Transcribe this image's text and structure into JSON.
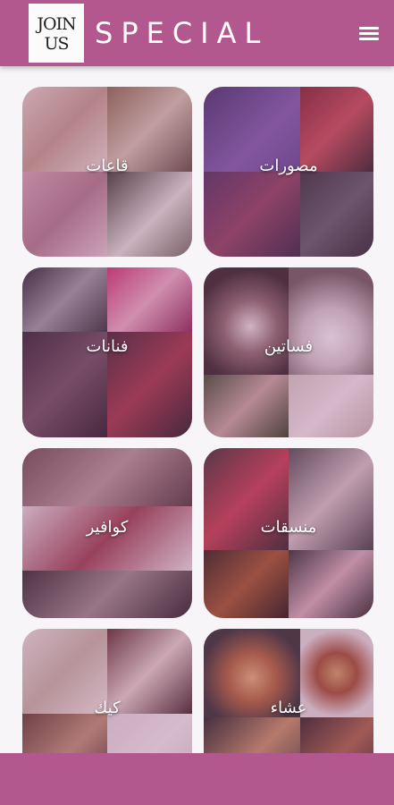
{
  "header": {
    "logo_line1": "JOIN",
    "logo_line2": "US",
    "title": "SPECIAL",
    "menu_icon": "hamburger-menu-icon"
  },
  "categories": [
    {
      "label": "مصورات"
    },
    {
      "label": "قاعات"
    },
    {
      "label": "فساتين"
    },
    {
      "label": "فنانات"
    },
    {
      "label": "منسقات"
    },
    {
      "label": "كوافير"
    },
    {
      "label": "عشاء"
    },
    {
      "label": "كيك"
    }
  ],
  "colors": {
    "primary": "#b3588f",
    "overlay": "rgba(150,80,130,0.35)",
    "background": "#f7f5f7"
  }
}
